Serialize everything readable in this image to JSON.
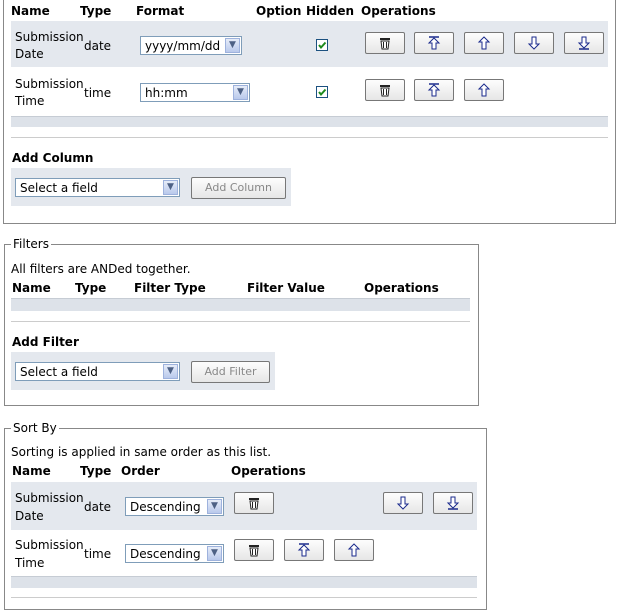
{
  "columns_section": {
    "headers": {
      "name": "Name",
      "type": "Type",
      "format": "Format",
      "option": "Option",
      "hidden": "Hidden",
      "operations": "Operations"
    },
    "rows": [
      {
        "name_line1": "Submission",
        "name_line2": "Date",
        "type": "date",
        "format": "yyyy/mm/dd",
        "hidden": true
      },
      {
        "name_line1": "Submission",
        "name_line2": "Time",
        "type": "time",
        "format": "hh:mm",
        "hidden": true
      }
    ],
    "add_column": {
      "label": "Add Column",
      "select_value": "Select a field",
      "button": "Add Column"
    }
  },
  "filters_section": {
    "legend": "Filters",
    "note": "All filters are ANDed together.",
    "headers": {
      "name": "Name",
      "type": "Type",
      "filter_type": "Filter Type",
      "filter_value": "Filter Value",
      "operations": "Operations"
    },
    "add_filter": {
      "label": "Add Filter",
      "select_value": "Select a field",
      "button": "Add Filter"
    }
  },
  "sort_section": {
    "legend": "Sort By",
    "note": "Sorting is applied in same order as this list.",
    "headers": {
      "name": "Name",
      "type": "Type",
      "order": "Order",
      "operations": "Operations"
    },
    "rows": [
      {
        "name_line1": "Submission",
        "name_line2": "Date",
        "type": "date",
        "order": "Descending"
      },
      {
        "name_line1": "Submission",
        "name_line2": "Time",
        "type": "time",
        "order": "Descending"
      }
    ]
  },
  "icons": [
    "trash-icon",
    "move-top-icon",
    "move-up-icon",
    "move-down-icon",
    "move-bottom-icon",
    "checkmark-icon",
    "dropdown-arrow-icon"
  ],
  "colors": {
    "row_background": "#e4e8ee",
    "checkbox_check": "#1d8a1d",
    "arrow_icon": "#1a2a8c"
  }
}
